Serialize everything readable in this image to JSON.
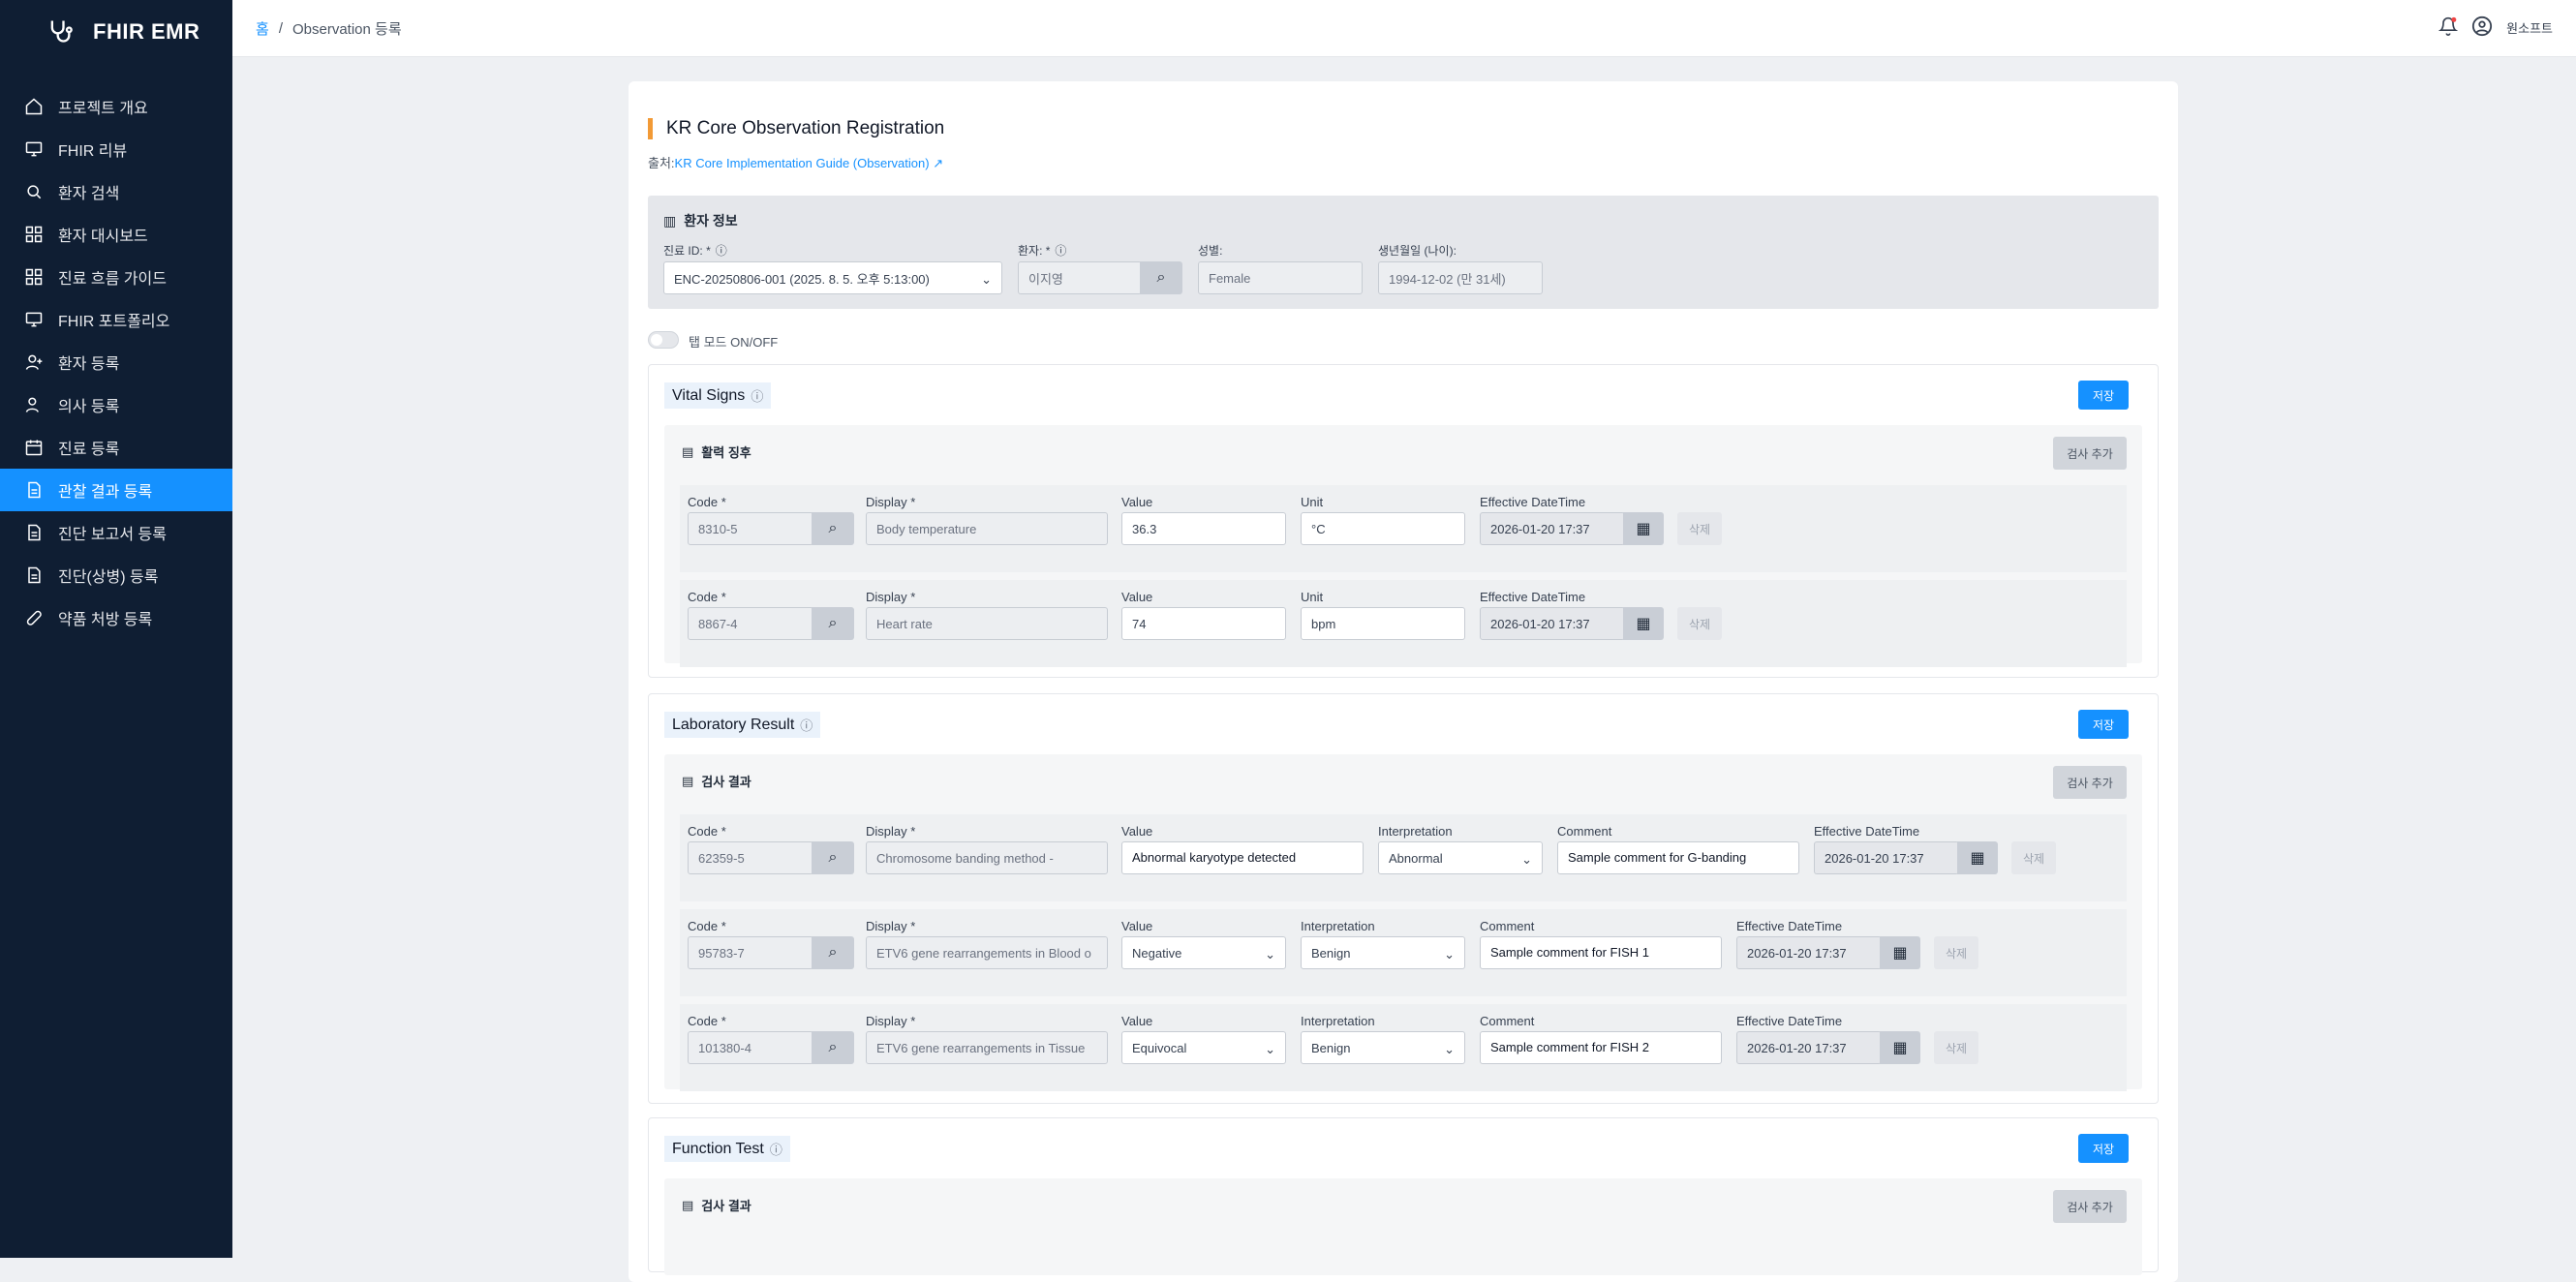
{
  "app": {
    "name": "FHIR EMR"
  },
  "sidebar": {
    "items": [
      {
        "label": "프로젝트 개요",
        "icon": "home-icon"
      },
      {
        "label": "FHIR 리뷰",
        "icon": "monitor-icon"
      },
      {
        "label": "환자 검색",
        "icon": "search-icon"
      },
      {
        "label": "환자 대시보드",
        "icon": "dashboard-icon"
      },
      {
        "label": "진료 흐름 가이드",
        "icon": "dashboard-icon"
      },
      {
        "label": "FHIR 포트폴리오",
        "icon": "monitor-icon"
      },
      {
        "label": "환자 등록",
        "icon": "user-plus-icon"
      },
      {
        "label": "의사 등록",
        "icon": "user-icon"
      },
      {
        "label": "진료 등록",
        "icon": "calendar-icon"
      },
      {
        "label": "관찰 결과 등록",
        "icon": "document-icon"
      },
      {
        "label": "진단 보고서 등록",
        "icon": "document-icon"
      },
      {
        "label": "진단(상병) 등록",
        "icon": "document-icon"
      },
      {
        "label": "약품 처방 등록",
        "icon": "pill-icon"
      }
    ],
    "active_index": 9
  },
  "breadcrumb": {
    "home": "홈",
    "sep": "/",
    "current": "Observation 등록"
  },
  "header": {
    "user": "원소프트"
  },
  "page": {
    "title": "KR Core Observation Registration",
    "source_prefix": "출처:",
    "source_link": "KR Core Implementation Guide (Observation)"
  },
  "patient": {
    "heading": "환자 정보",
    "encounter_label": "진료 ID: *",
    "encounter_value": "ENC-20250806-001 (2025. 8. 5. 오후 5:13:00)",
    "patient_label": "환자: *",
    "patient_value": "이지영",
    "gender_label": "성별:",
    "gender_value": "Female",
    "birth_label": "생년월일 (나이):",
    "birth_value": "1994-12-02 (만 31세)"
  },
  "toggle": {
    "label": "탭 모드 ON/OFF"
  },
  "labels": {
    "code": "Code *",
    "display": "Display *",
    "value": "Value",
    "unit": "Unit",
    "effective": "Effective DateTime",
    "interpretation": "Interpretation",
    "comment": "Comment",
    "delete": "삭제",
    "add": "검사 추가",
    "save": "저장"
  },
  "vital": {
    "title": "Vital Signs",
    "subheading": "활력 징후",
    "rows": [
      {
        "code": "8310-5",
        "display": "Body temperature",
        "value": "36.3",
        "unit": "°C",
        "effective": "2026-01-20 17:37"
      },
      {
        "code": "8867-4",
        "display": "Heart rate",
        "value": "74",
        "unit": "bpm",
        "effective": "2026-01-20 17:37"
      }
    ]
  },
  "lab": {
    "title": "Laboratory Result",
    "subheading": "검사 결과",
    "rows": [
      {
        "code": "62359-5",
        "display": "Chromosome banding method -",
        "value": "Abnormal karyotype detected",
        "interpretation": "Abnormal",
        "comment": "Sample comment for G-banding",
        "effective": "2026-01-20 17:37"
      },
      {
        "code": "95783-7",
        "display": "ETV6 gene rearrangements in Blood o",
        "value": "Negative",
        "interpretation": "Benign",
        "comment": "Sample comment for FISH 1",
        "effective": "2026-01-20 17:37"
      },
      {
        "code": "101380-4",
        "display": "ETV6 gene rearrangements in Tissue",
        "value": "Equivocal",
        "interpretation": "Benign",
        "comment": "Sample comment for FISH 2",
        "effective": "2026-01-20 17:37"
      }
    ]
  },
  "function": {
    "title": "Function Test",
    "subheading": "검사 결과"
  }
}
